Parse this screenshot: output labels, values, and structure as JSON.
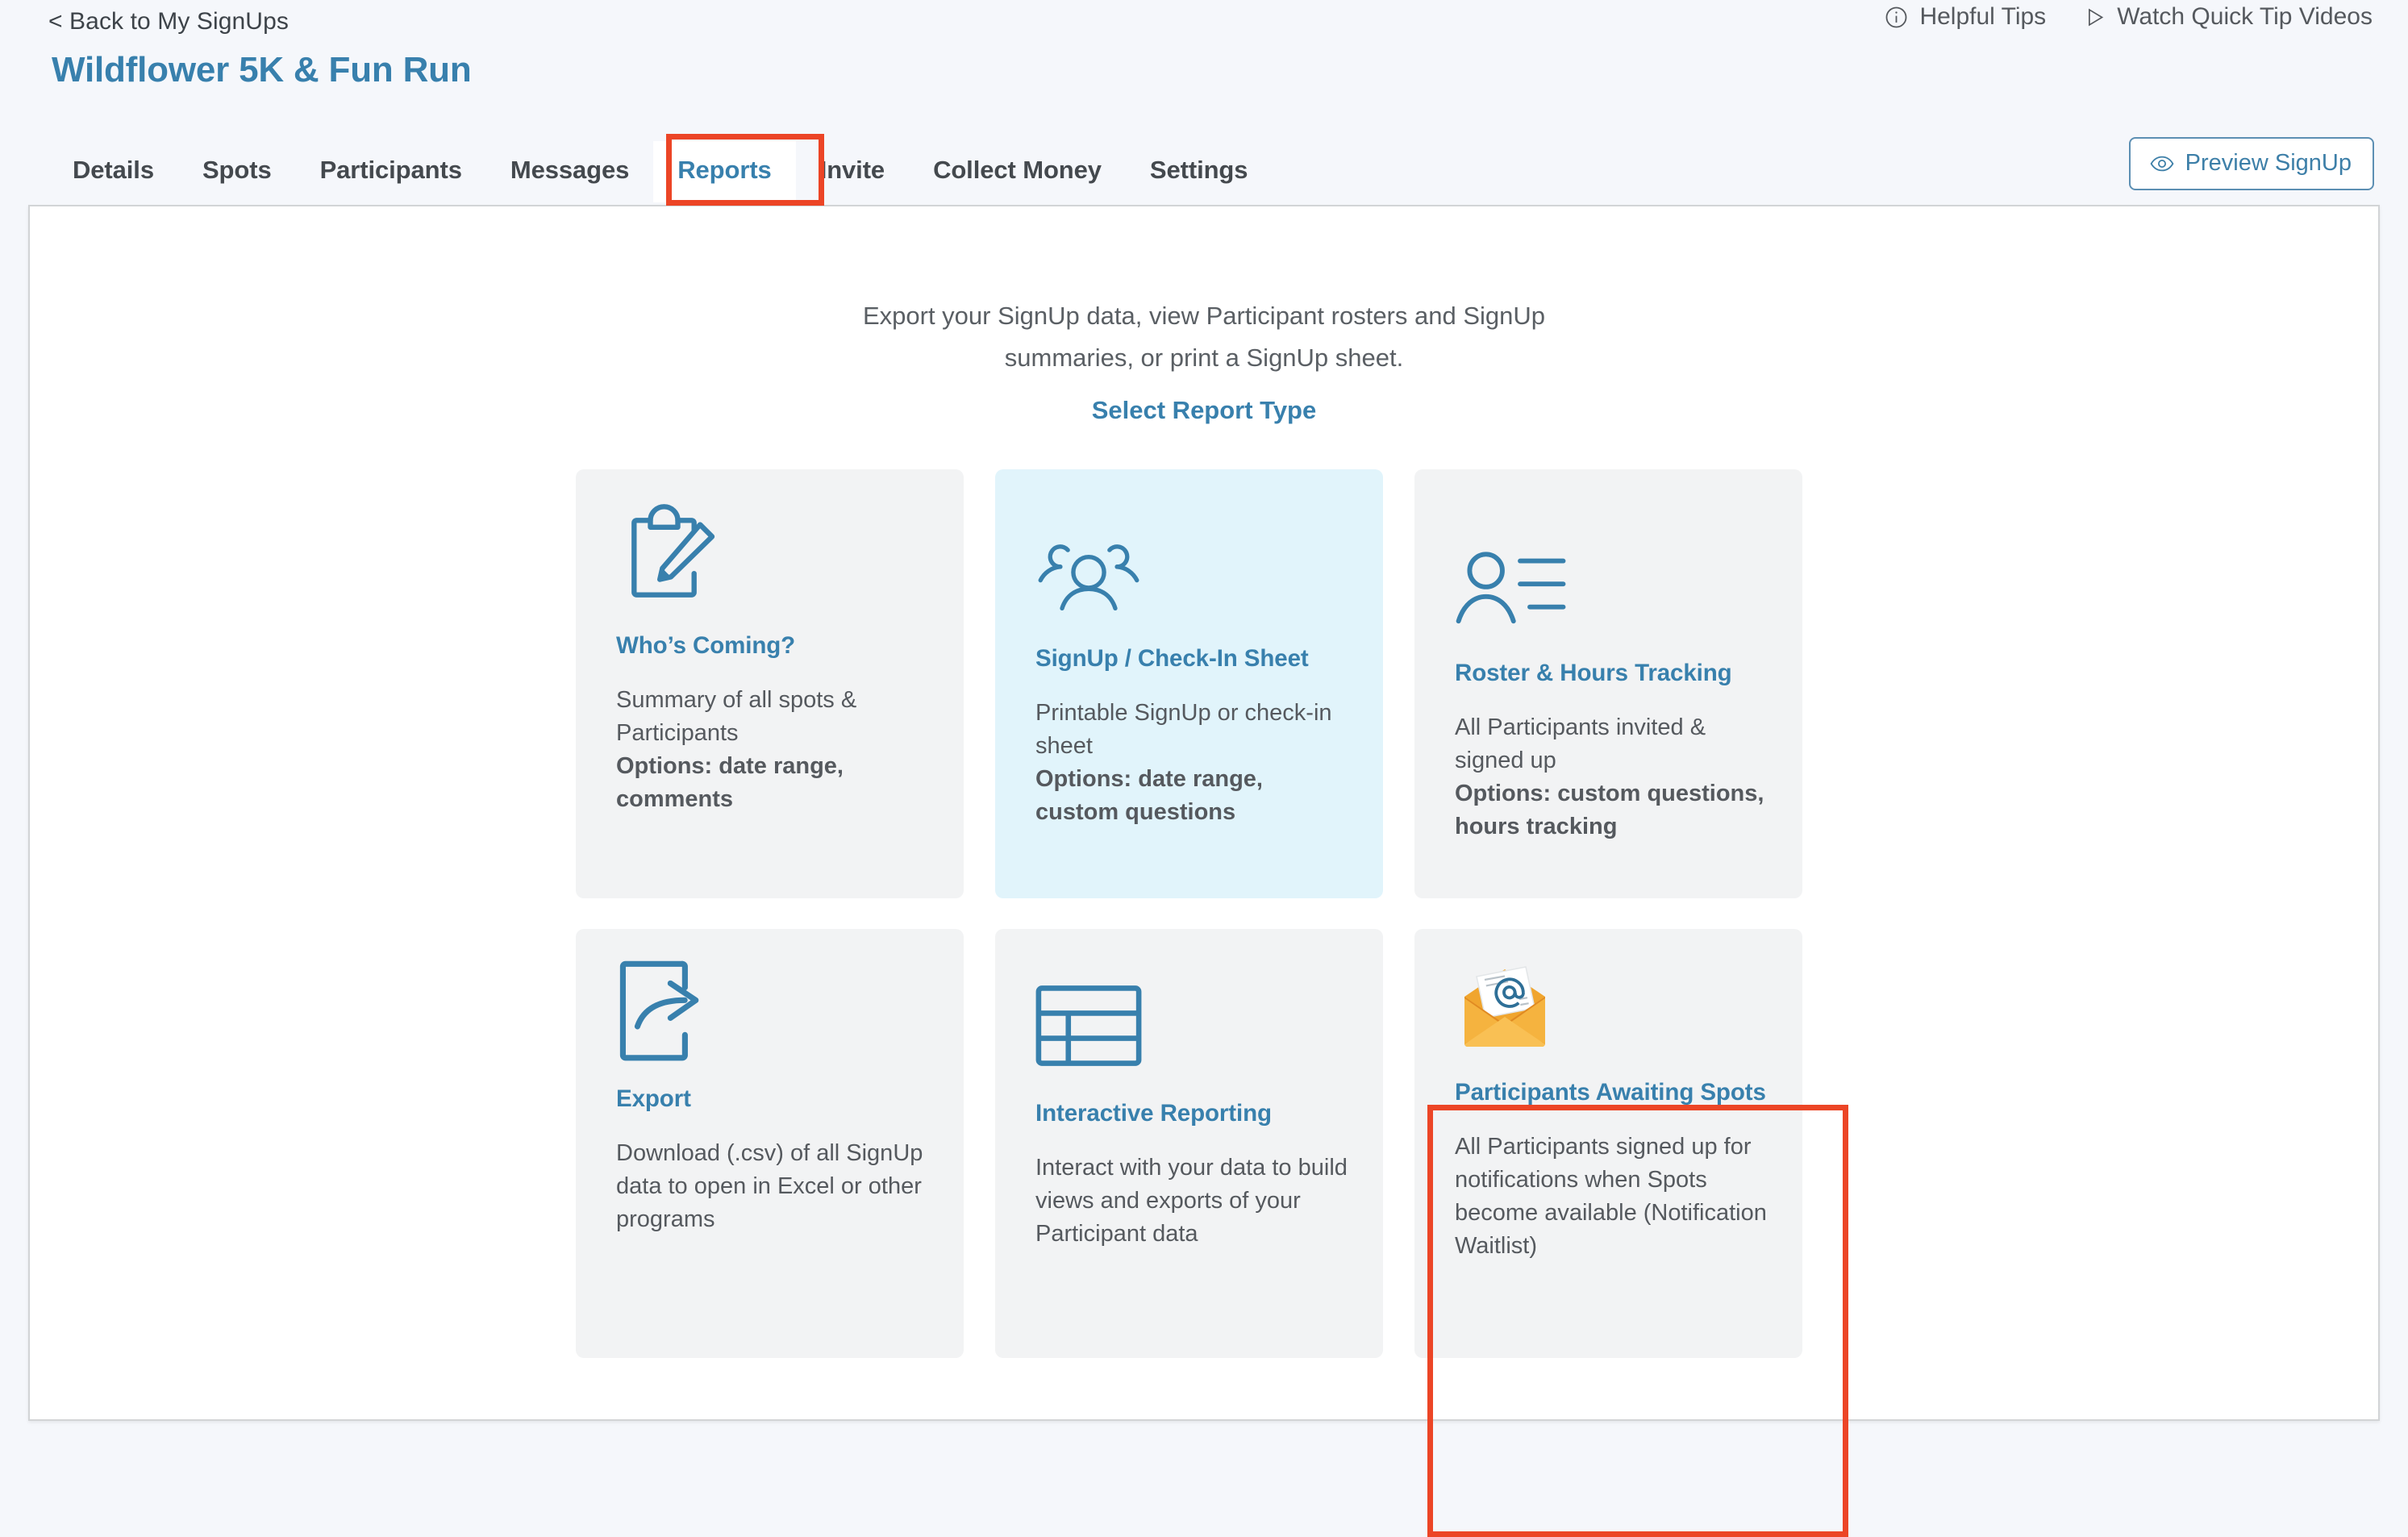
{
  "header": {
    "back_link": "< Back to My SignUps",
    "title": "Wildflower 5K & Fun Run",
    "tips": [
      {
        "label": "Helpful Tips",
        "icon": "info-circle-icon"
      },
      {
        "label": "Watch Quick Tip Videos",
        "icon": "play-triangle-icon"
      }
    ],
    "preview_button": {
      "label": "Preview SignUp",
      "icon": "eye-icon"
    }
  },
  "nav": {
    "tabs": [
      {
        "label": "Details",
        "active": false
      },
      {
        "label": "Spots",
        "active": false
      },
      {
        "label": "Participants",
        "active": false
      },
      {
        "label": "Messages",
        "active": false
      },
      {
        "label": "Reports",
        "active": true
      },
      {
        "label": "Invite",
        "active": false
      },
      {
        "label": "Collect Money",
        "active": false
      },
      {
        "label": "Settings",
        "active": false
      }
    ]
  },
  "main": {
    "intro_line1": "Export your SignUp data, view Participant rosters and SignUp",
    "intro_line2": "summaries, or print a SignUp sheet.",
    "select_report_type": "Select Report Type",
    "cards": [
      {
        "id": "whos-coming",
        "icon": "clipboard-pencil-icon",
        "title": "Who’s Coming?",
        "desc": "Summary of all spots & Participants",
        "options": "Options: date range, comments",
        "tinted": false
      },
      {
        "id": "signup-check-in-sheet",
        "icon": "people-group-icon",
        "title": "SignUp / Check-In Sheet",
        "desc": "Printable SignUp or check-in sheet",
        "options": "Options: date range, custom questions",
        "tinted": true
      },
      {
        "id": "roster-hours-tracking",
        "icon": "person-lines-icon",
        "title": "Roster & Hours Tracking",
        "desc": "All Participants invited & signed up",
        "options": "Options: custom questions, hours tracking",
        "tinted": false
      },
      {
        "id": "export",
        "icon": "export-arrow-icon",
        "title": "Export",
        "desc": "Download (.csv) of all SignUp data to open in Excel or other programs",
        "options": "",
        "tinted": false
      },
      {
        "id": "interactive-reporting",
        "icon": "table-grid-icon",
        "title": "Interactive Reporting",
        "desc": "Interact with your data to build views and exports of your Participant data",
        "options": "",
        "tinted": false
      },
      {
        "id": "participants-awaiting-spots",
        "icon": "open-envelope-at-icon",
        "title": "Participants Awaiting Spots",
        "desc": "All Participants signed up for notifications when Spots become available (Notification Waitlist)",
        "options": "",
        "tinted": false
      }
    ]
  },
  "highlights": {
    "color": "#ec4526",
    "targets": [
      "Reports",
      "Participants Awaiting Spots"
    ]
  },
  "colors": {
    "page_background": "#f5f7fb",
    "panel_background": "#ffffff",
    "brand_blue": "#3880ad",
    "card_grey": "#f2f3f4",
    "card_tint": "#e1f4fb",
    "body_text": "#55595e",
    "highlight_red": "#ec4526"
  }
}
